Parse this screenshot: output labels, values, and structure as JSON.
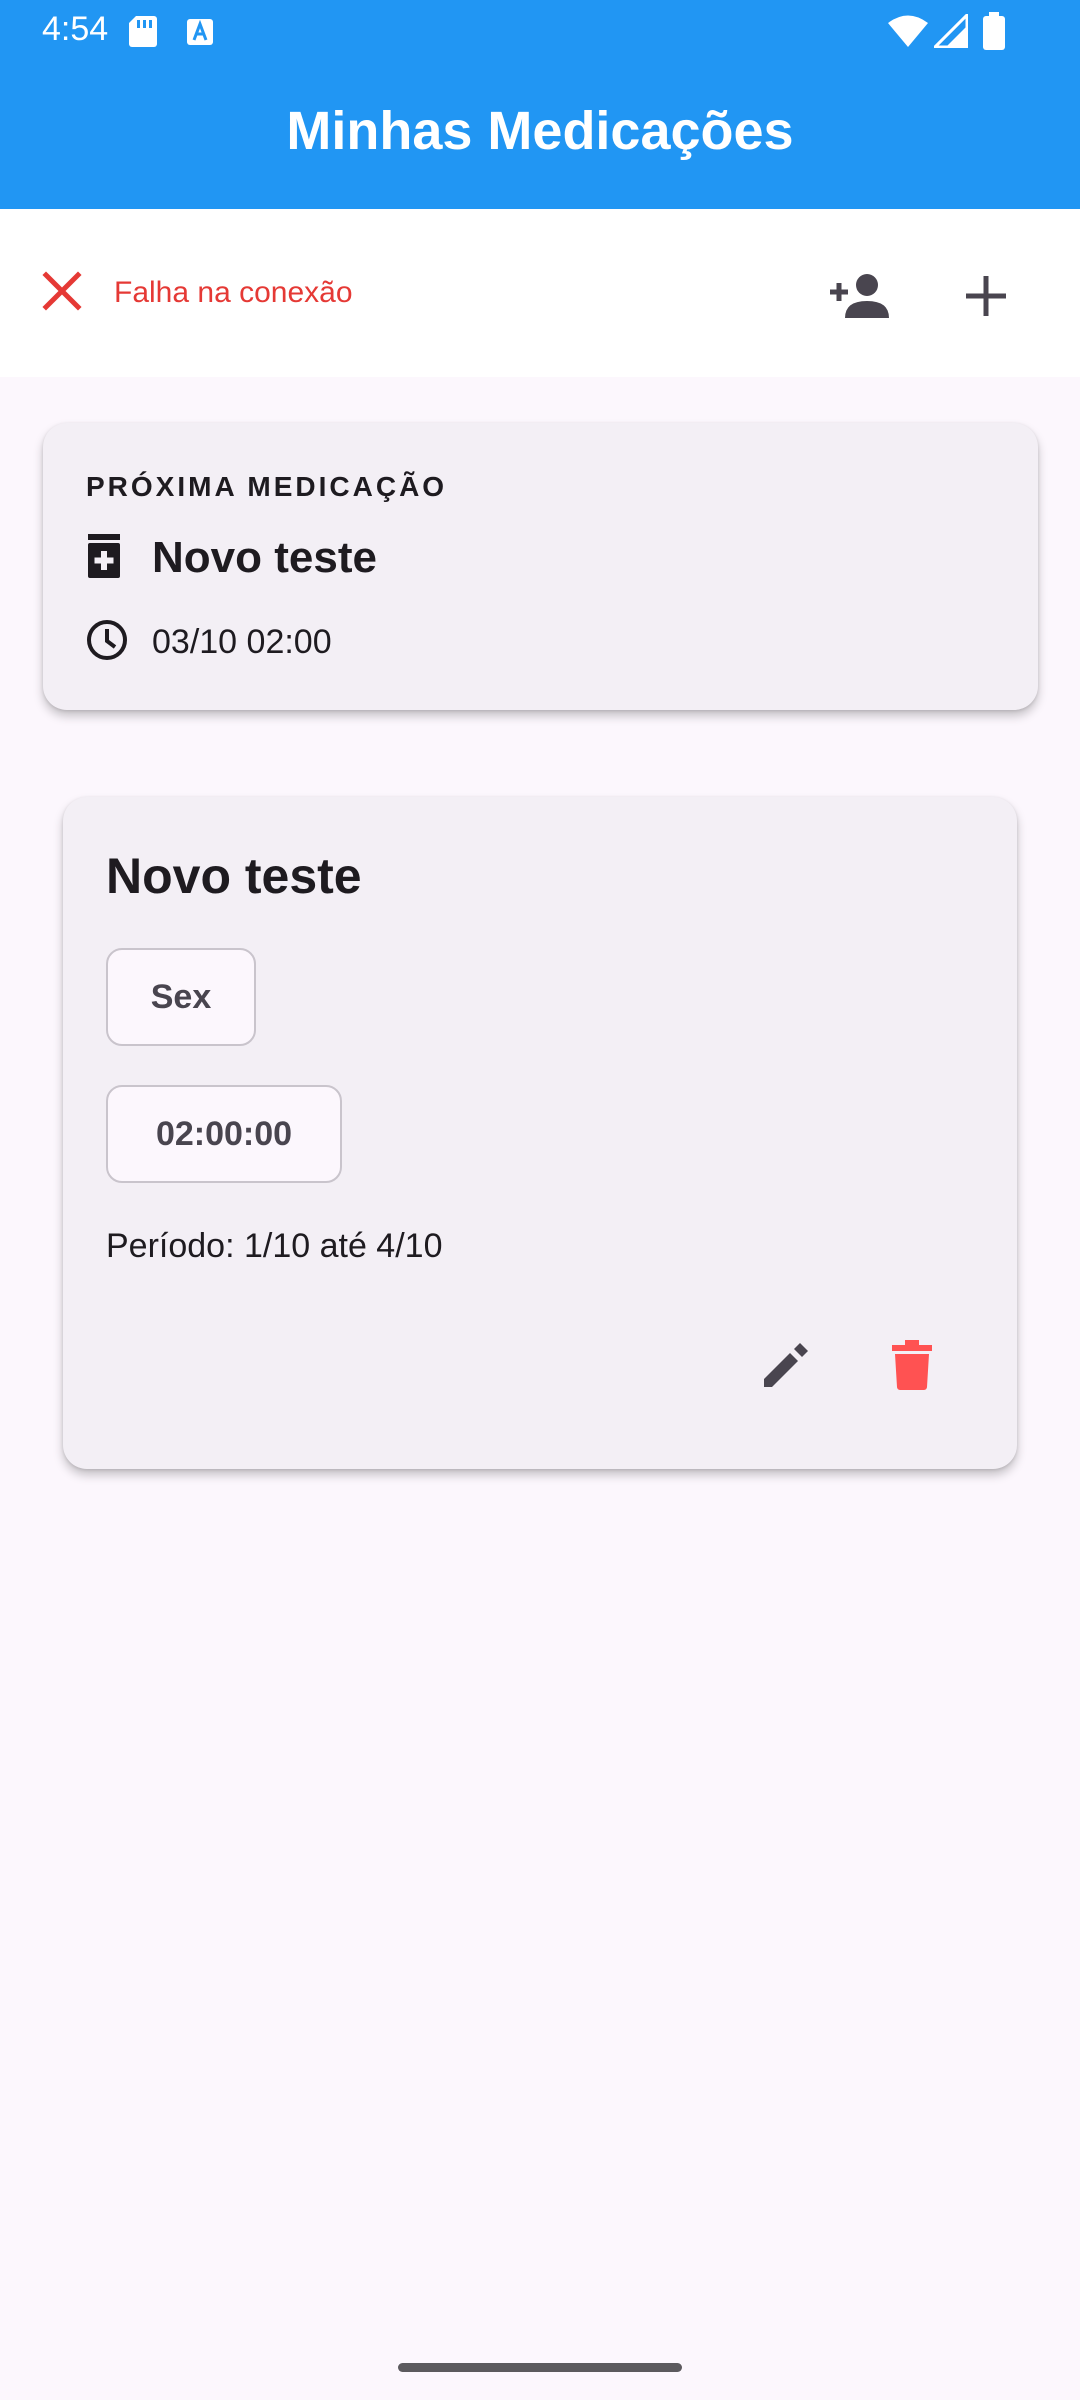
{
  "status_bar": {
    "time": "4:54",
    "icons": [
      "sd-card-icon",
      "font-a-icon",
      "wifi-icon",
      "signal-icon",
      "battery-icon"
    ]
  },
  "app_bar": {
    "title": "Minhas Medicações",
    "background": "#2196F3"
  },
  "toolbar": {
    "connection_status": "Falha na conexão",
    "connection_icon": "close-icon",
    "error_color": "#E53935",
    "actions": [
      {
        "name": "add-person-icon"
      },
      {
        "name": "add-icon"
      }
    ]
  },
  "next_medication": {
    "label": "PRÓXIMA MEDICAÇÃO",
    "name": "Novo teste",
    "name_icon": "medication-bottle-icon",
    "time_icon": "clock-icon",
    "datetime": "03/10 02:00"
  },
  "medication_list": [
    {
      "name": "Novo teste",
      "days": [
        "Sex"
      ],
      "times": [
        "02:00:00"
      ],
      "period": "Período: 1/10 até 4/10",
      "actions": [
        {
          "name": "edit-icon"
        },
        {
          "name": "delete-icon",
          "color": "#FF5252"
        }
      ]
    }
  ]
}
